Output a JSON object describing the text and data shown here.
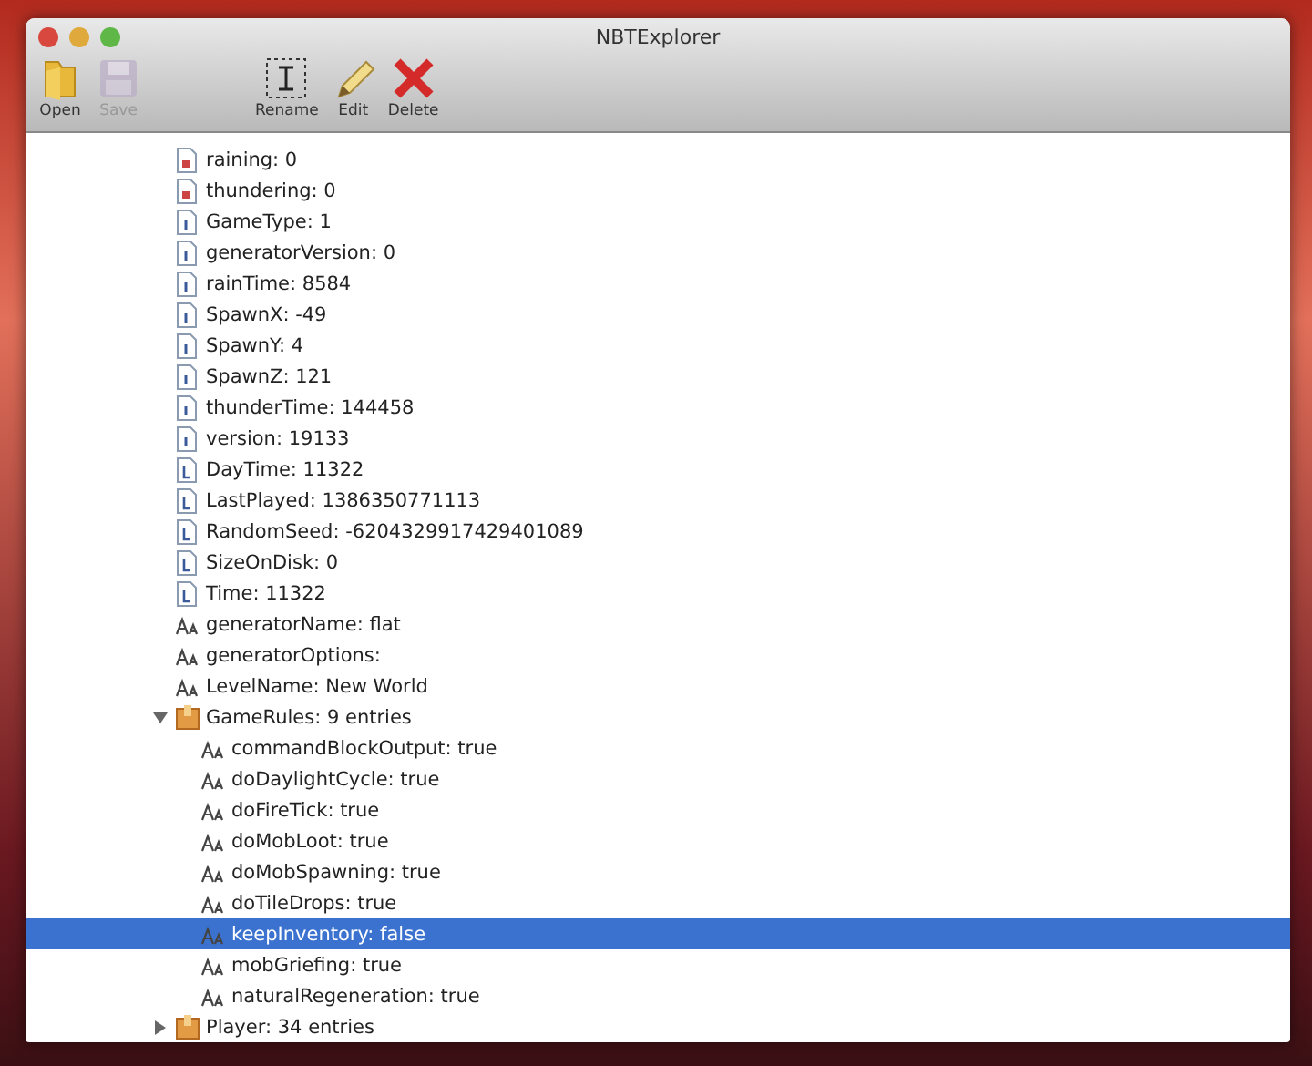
{
  "window": {
    "title": "NBTExplorer"
  },
  "toolbar": [
    {
      "kind": "open",
      "label": "Open",
      "disabled": false
    },
    {
      "kind": "save",
      "label": "Save",
      "disabled": true
    },
    {
      "kind": "rename",
      "label": "Rename",
      "disabled": false
    },
    {
      "kind": "edit",
      "label": "Edit",
      "disabled": false
    },
    {
      "kind": "delete",
      "label": "Delete",
      "disabled": false
    }
  ],
  "tree": [
    {
      "kind": "byte",
      "label": "raining: 0",
      "selected": false
    },
    {
      "kind": "byte",
      "label": "thundering: 0",
      "selected": false
    },
    {
      "kind": "int",
      "label": "GameType: 1",
      "selected": false
    },
    {
      "kind": "int",
      "label": "generatorVersion: 0",
      "selected": false
    },
    {
      "kind": "int",
      "label": "rainTime: 8584",
      "selected": false
    },
    {
      "kind": "int",
      "label": "SpawnX: -49",
      "selected": false
    },
    {
      "kind": "int",
      "label": "SpawnY: 4",
      "selected": false
    },
    {
      "kind": "int",
      "label": "SpawnZ: 121",
      "selected": false
    },
    {
      "kind": "int",
      "label": "thunderTime: 144458",
      "selected": false
    },
    {
      "kind": "int",
      "label": "version: 19133",
      "selected": false
    },
    {
      "kind": "long",
      "label": "DayTime: 11322",
      "selected": false
    },
    {
      "kind": "long",
      "label": "LastPlayed: 1386350771113",
      "selected": false
    },
    {
      "kind": "long",
      "label": "RandomSeed: -6204329917429401089",
      "selected": false
    },
    {
      "kind": "long",
      "label": "SizeOnDisk: 0",
      "selected": false
    },
    {
      "kind": "long",
      "label": "Time: 11322",
      "selected": false
    },
    {
      "kind": "string",
      "label": "generatorName: flat",
      "selected": false
    },
    {
      "kind": "string",
      "label": "generatorOptions:",
      "selected": false
    },
    {
      "kind": "string",
      "label": "LevelName: New World",
      "selected": false
    },
    {
      "kind": "compound",
      "label": "GameRules: 9 entries",
      "selected": false,
      "expanded": true,
      "children": [
        {
          "kind": "string",
          "label": "commandBlockOutput: true",
          "selected": false
        },
        {
          "kind": "string",
          "label": "doDaylightCycle: true",
          "selected": false
        },
        {
          "kind": "string",
          "label": "doFireTick: true",
          "selected": false
        },
        {
          "kind": "string",
          "label": "doMobLoot: true",
          "selected": false
        },
        {
          "kind": "string",
          "label": "doMobSpawning: true",
          "selected": false
        },
        {
          "kind": "string",
          "label": "doTileDrops: true",
          "selected": false
        },
        {
          "kind": "string",
          "label": "keepInventory: false",
          "selected": true
        },
        {
          "kind": "string",
          "label": "mobGriefing: true",
          "selected": false
        },
        {
          "kind": "string",
          "label": "naturalRegeneration: true",
          "selected": false
        }
      ]
    },
    {
      "kind": "compound",
      "label": "Player: 34 entries",
      "selected": false,
      "expanded": false
    }
  ]
}
